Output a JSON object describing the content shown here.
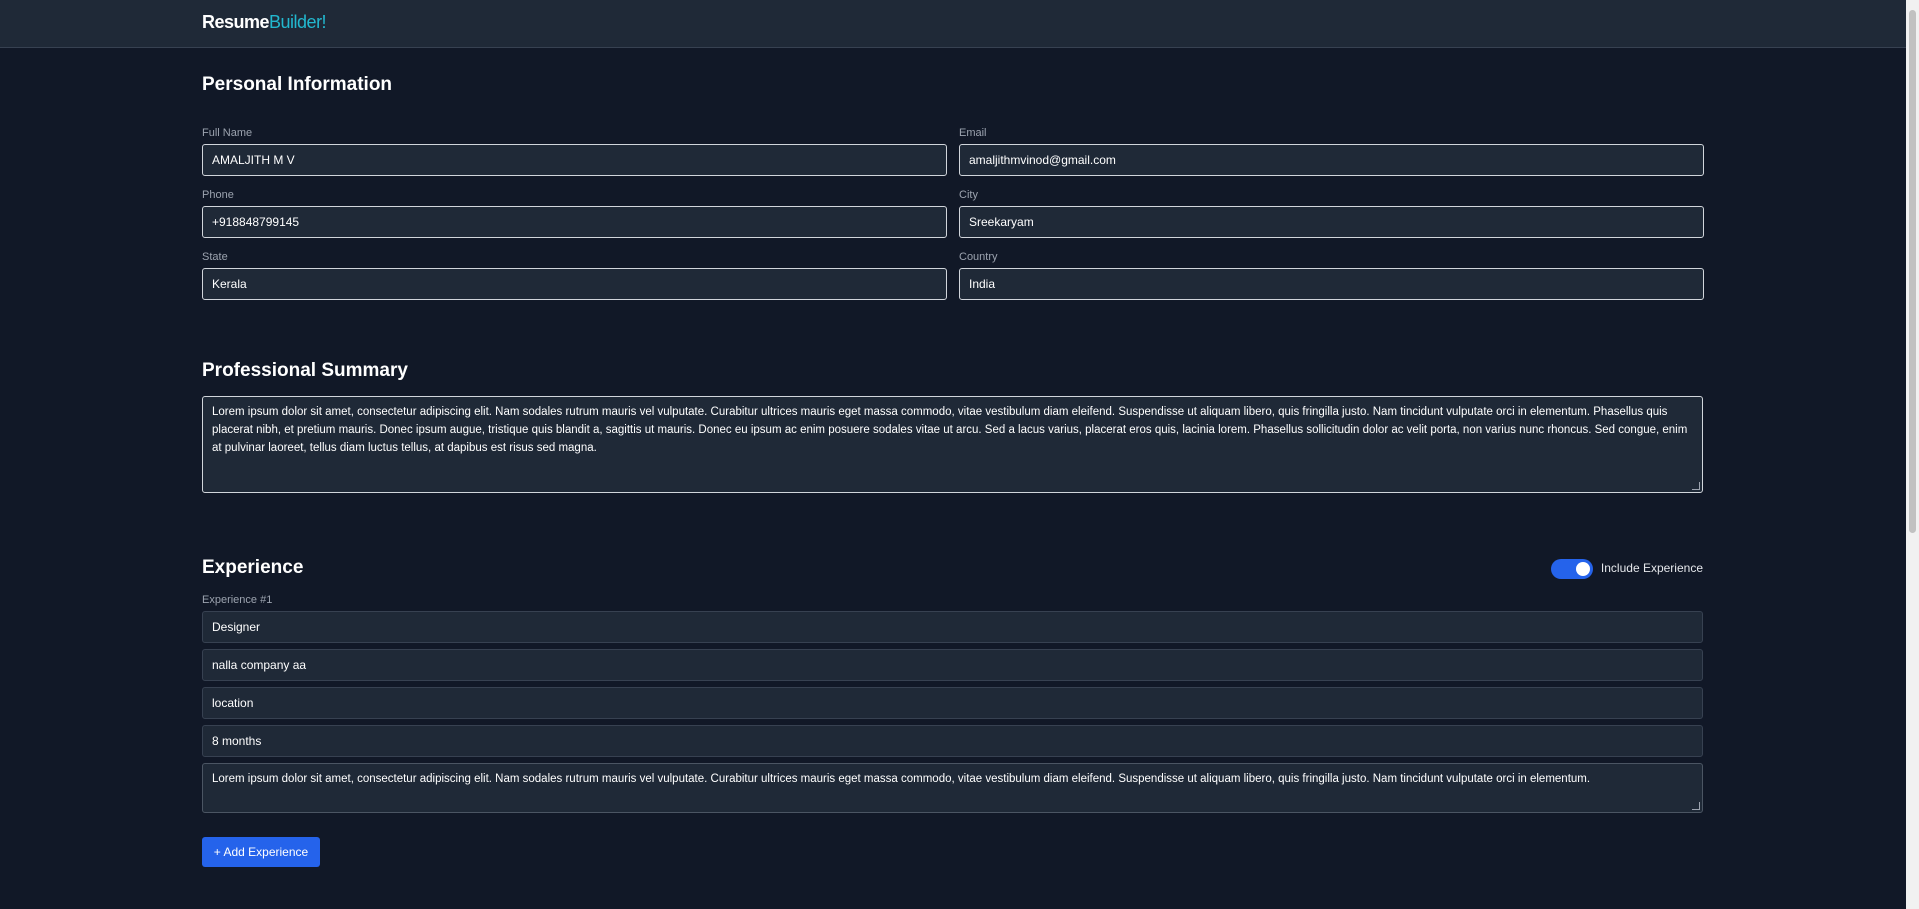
{
  "app": {
    "logo_part1": "Resume",
    "logo_part2": "Builder!"
  },
  "personal": {
    "title": "Personal Information",
    "full_name_label": "Full Name",
    "full_name": "AMALJITH M V",
    "email_label": "Email",
    "email": "amaljithmvinod@gmail.com",
    "phone_label": "Phone",
    "phone": "+918848799145",
    "city_label": "City",
    "city": "Sreekaryam",
    "state_label": "State",
    "state": "Kerala",
    "country_label": "Country",
    "country": "India"
  },
  "summary": {
    "title": "Professional Summary",
    "text": "Lorem ipsum dolor sit amet, consectetur adipiscing elit. Nam sodales rutrum mauris vel vulputate. Curabitur ultrices mauris eget massa commodo, vitae vestibulum diam eleifend. Suspendisse ut aliquam libero, quis fringilla justo. Nam tincidunt vulputate orci in elementum. Phasellus quis placerat nibh, et pretium mauris. Donec ipsum augue, tristique quis blandit a, sagittis ut mauris. Donec eu ipsum ac enim posuere sodales vitae ut arcu. Sed a lacus varius, placerat eros quis, lacinia lorem. Phasellus sollicitudin dolor ac velit porta, non varius nunc rhoncus. Sed congue, enim at pulvinar laoreet, tellus diam luctus tellus, at dapibus est risus sed magna."
  },
  "experience": {
    "title": "Experience",
    "include_label": "Include Experience",
    "include_enabled": true,
    "entry_label": "Experience #1",
    "role": "Designer",
    "company": "nalla company aa",
    "location": "location",
    "duration": "8 months",
    "description": "Lorem ipsum dolor sit amet, consectetur adipiscing elit. Nam sodales rutrum mauris vel vulputate. Curabitur ultrices mauris eget massa commodo, vitae vestibulum diam eleifend. Suspendisse ut aliquam libero, quis fringilla justo. Nam tincidunt vulputate orci in elementum.",
    "add_button": "+ Add Experience"
  },
  "colors": {
    "accent": "#2563eb",
    "brand": "#22b8cf",
    "background": "#111827",
    "surface": "#1f2937"
  }
}
